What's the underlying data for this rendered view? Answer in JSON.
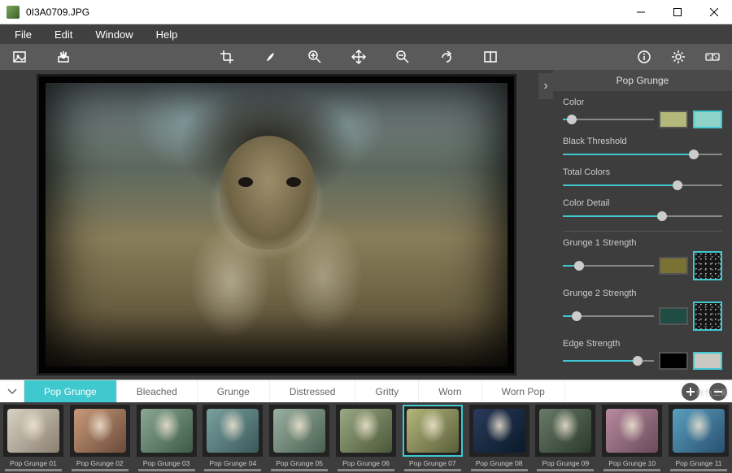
{
  "window": {
    "title": "0I3A0709.JPG"
  },
  "menu": [
    "File",
    "Edit",
    "Window",
    "Help"
  ],
  "toolbar": {
    "left": [
      {
        "name": "image-icon"
      },
      {
        "name": "save-icon"
      }
    ],
    "middle": [
      {
        "name": "crop-icon"
      },
      {
        "name": "brush-icon"
      },
      {
        "name": "zoom-in-icon"
      },
      {
        "name": "pan-icon"
      },
      {
        "name": "zoom-out-icon"
      },
      {
        "name": "redo-icon"
      },
      {
        "name": "compare-icon"
      }
    ],
    "right": [
      {
        "name": "info-icon"
      },
      {
        "name": "settings-icon"
      },
      {
        "name": "random-icon"
      }
    ]
  },
  "panel": {
    "title": "Pop Grunge",
    "props": [
      {
        "label": "Color",
        "value": 10,
        "swatches": [
          "#b4b87a",
          "#8fd3c9"
        ],
        "selected": 1
      },
      {
        "label": "Black Threshold",
        "value": 82
      },
      {
        "label": "Total Colors",
        "value": 72
      },
      {
        "label": "Color Detail",
        "value": 62
      },
      {
        "label": "Grunge 1 Strength",
        "value": 18,
        "swatches": [
          "#7a7232"
        ],
        "tex": true,
        "texSelected": true
      },
      {
        "label": "Grunge 2 Strength",
        "value": 15,
        "swatches": [
          "#1f4d43"
        ],
        "tex": true,
        "texSelected": true
      },
      {
        "label": "Edge Strength",
        "value": 82,
        "swatches": [
          "#000000",
          "#c9c9c2"
        ],
        "selected": 1
      }
    ]
  },
  "categories": [
    "Pop Grunge",
    "Bleached",
    "Grunge",
    "Distressed",
    "Gritty",
    "Worn",
    "Worn Pop"
  ],
  "activeCategory": 0,
  "presets": [
    {
      "label": "Pop Grunge 01",
      "bg": "linear-gradient(135deg,#d8d2c4,#8a8070)"
    },
    {
      "label": "Pop Grunge 02",
      "bg": "linear-gradient(135deg,#c99a7a,#6b4a3a)"
    },
    {
      "label": "Pop Grunge 03",
      "bg": "linear-gradient(135deg,#8aa894,#3d5a48)"
    },
    {
      "label": "Pop Grunge 04",
      "bg": "linear-gradient(135deg,#7aa0a0,#3a5a5a)"
    },
    {
      "label": "Pop Grunge 05",
      "bg": "linear-gradient(135deg,#9ab0a0,#4a6050)"
    },
    {
      "label": "Pop Grunge 06",
      "bg": "linear-gradient(135deg,#9aa884,#4a5838)"
    },
    {
      "label": "Pop Grunge 07",
      "bg": "linear-gradient(135deg,#b4b87a,#5a5e3a)"
    },
    {
      "label": "Pop Grunge 08",
      "bg": "linear-gradient(135deg,#2a3a5a,#0a1a2a)"
    },
    {
      "label": "Pop Grunge 09",
      "bg": "linear-gradient(135deg,#6a7a6a,#2a3a2a)"
    },
    {
      "label": "Pop Grunge 10",
      "bg": "linear-gradient(135deg,#b88aa0,#6a4a5a)"
    },
    {
      "label": "Pop Grunge 11",
      "bg": "linear-gradient(135deg,#5aa0c0,#2a5070)"
    }
  ],
  "selectedPreset": 6,
  "watermark": "綠色工廠"
}
